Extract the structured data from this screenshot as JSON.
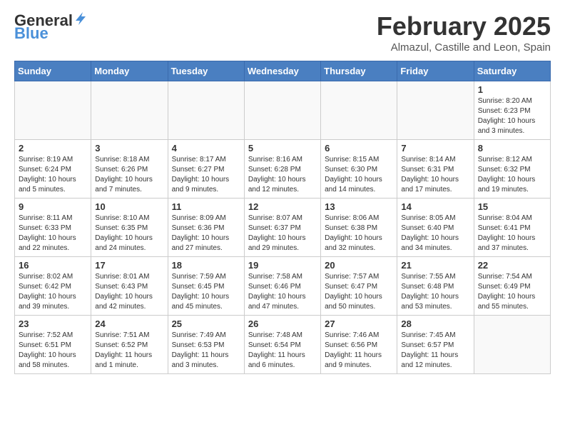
{
  "header": {
    "logo_general": "General",
    "logo_blue": "Blue",
    "title": "February 2025",
    "location": "Almazul, Castille and Leon, Spain"
  },
  "days_of_week": [
    "Sunday",
    "Monday",
    "Tuesday",
    "Wednesday",
    "Thursday",
    "Friday",
    "Saturday"
  ],
  "weeks": [
    [
      {
        "day": "",
        "info": ""
      },
      {
        "day": "",
        "info": ""
      },
      {
        "day": "",
        "info": ""
      },
      {
        "day": "",
        "info": ""
      },
      {
        "day": "",
        "info": ""
      },
      {
        "day": "",
        "info": ""
      },
      {
        "day": "1",
        "info": "Sunrise: 8:20 AM\nSunset: 6:23 PM\nDaylight: 10 hours and 3 minutes."
      }
    ],
    [
      {
        "day": "2",
        "info": "Sunrise: 8:19 AM\nSunset: 6:24 PM\nDaylight: 10 hours and 5 minutes."
      },
      {
        "day": "3",
        "info": "Sunrise: 8:18 AM\nSunset: 6:26 PM\nDaylight: 10 hours and 7 minutes."
      },
      {
        "day": "4",
        "info": "Sunrise: 8:17 AM\nSunset: 6:27 PM\nDaylight: 10 hours and 9 minutes."
      },
      {
        "day": "5",
        "info": "Sunrise: 8:16 AM\nSunset: 6:28 PM\nDaylight: 10 hours and 12 minutes."
      },
      {
        "day": "6",
        "info": "Sunrise: 8:15 AM\nSunset: 6:30 PM\nDaylight: 10 hours and 14 minutes."
      },
      {
        "day": "7",
        "info": "Sunrise: 8:14 AM\nSunset: 6:31 PM\nDaylight: 10 hours and 17 minutes."
      },
      {
        "day": "8",
        "info": "Sunrise: 8:12 AM\nSunset: 6:32 PM\nDaylight: 10 hours and 19 minutes."
      }
    ],
    [
      {
        "day": "9",
        "info": "Sunrise: 8:11 AM\nSunset: 6:33 PM\nDaylight: 10 hours and 22 minutes."
      },
      {
        "day": "10",
        "info": "Sunrise: 8:10 AM\nSunset: 6:35 PM\nDaylight: 10 hours and 24 minutes."
      },
      {
        "day": "11",
        "info": "Sunrise: 8:09 AM\nSunset: 6:36 PM\nDaylight: 10 hours and 27 minutes."
      },
      {
        "day": "12",
        "info": "Sunrise: 8:07 AM\nSunset: 6:37 PM\nDaylight: 10 hours and 29 minutes."
      },
      {
        "day": "13",
        "info": "Sunrise: 8:06 AM\nSunset: 6:38 PM\nDaylight: 10 hours and 32 minutes."
      },
      {
        "day": "14",
        "info": "Sunrise: 8:05 AM\nSunset: 6:40 PM\nDaylight: 10 hours and 34 minutes."
      },
      {
        "day": "15",
        "info": "Sunrise: 8:04 AM\nSunset: 6:41 PM\nDaylight: 10 hours and 37 minutes."
      }
    ],
    [
      {
        "day": "16",
        "info": "Sunrise: 8:02 AM\nSunset: 6:42 PM\nDaylight: 10 hours and 39 minutes."
      },
      {
        "day": "17",
        "info": "Sunrise: 8:01 AM\nSunset: 6:43 PM\nDaylight: 10 hours and 42 minutes."
      },
      {
        "day": "18",
        "info": "Sunrise: 7:59 AM\nSunset: 6:45 PM\nDaylight: 10 hours and 45 minutes."
      },
      {
        "day": "19",
        "info": "Sunrise: 7:58 AM\nSunset: 6:46 PM\nDaylight: 10 hours and 47 minutes."
      },
      {
        "day": "20",
        "info": "Sunrise: 7:57 AM\nSunset: 6:47 PM\nDaylight: 10 hours and 50 minutes."
      },
      {
        "day": "21",
        "info": "Sunrise: 7:55 AM\nSunset: 6:48 PM\nDaylight: 10 hours and 53 minutes."
      },
      {
        "day": "22",
        "info": "Sunrise: 7:54 AM\nSunset: 6:49 PM\nDaylight: 10 hours and 55 minutes."
      }
    ],
    [
      {
        "day": "23",
        "info": "Sunrise: 7:52 AM\nSunset: 6:51 PM\nDaylight: 10 hours and 58 minutes."
      },
      {
        "day": "24",
        "info": "Sunrise: 7:51 AM\nSunset: 6:52 PM\nDaylight: 11 hours and 1 minute."
      },
      {
        "day": "25",
        "info": "Sunrise: 7:49 AM\nSunset: 6:53 PM\nDaylight: 11 hours and 3 minutes."
      },
      {
        "day": "26",
        "info": "Sunrise: 7:48 AM\nSunset: 6:54 PM\nDaylight: 11 hours and 6 minutes."
      },
      {
        "day": "27",
        "info": "Sunrise: 7:46 AM\nSunset: 6:56 PM\nDaylight: 11 hours and 9 minutes."
      },
      {
        "day": "28",
        "info": "Sunrise: 7:45 AM\nSunset: 6:57 PM\nDaylight: 11 hours and 12 minutes."
      },
      {
        "day": "",
        "info": ""
      }
    ]
  ]
}
